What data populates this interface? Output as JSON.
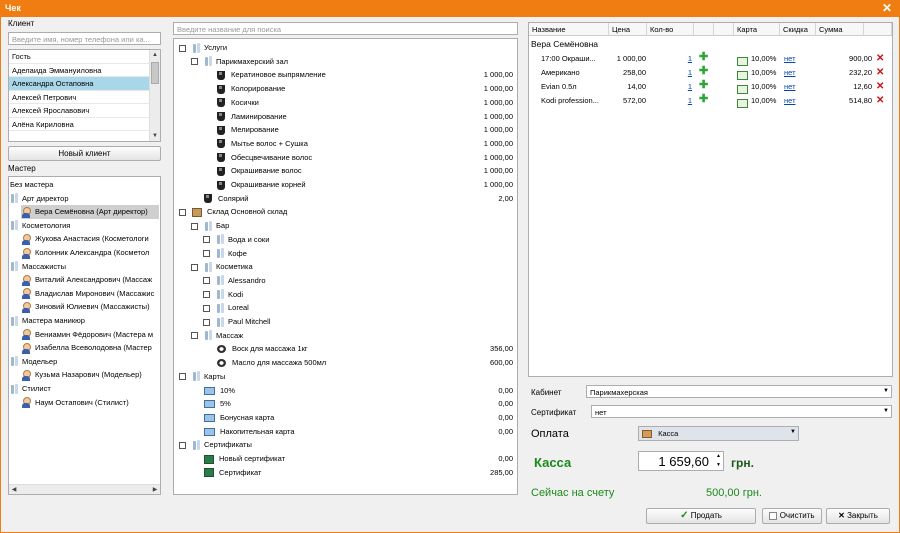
{
  "window": {
    "title": "Чек"
  },
  "client": {
    "label": "Клиент",
    "search_placeholder": "Введите имя, номер телефона или ка...",
    "list": [
      "Гость",
      "Аделаида Эммануиловна",
      "Александра Остаповна",
      "Алексей Петрович",
      "Алексей Ярославович",
      "Алёна Кириловна"
    ],
    "selected_index": 2,
    "new_client_button": "Новый клиент"
  },
  "master": {
    "label": "Мастер",
    "rows": [
      {
        "type": "plain",
        "text": "Без мастера"
      },
      {
        "type": "group",
        "text": "Арт директор"
      },
      {
        "type": "person",
        "text": "Вера Семёновна (Арт директор)",
        "selected": true
      },
      {
        "type": "group",
        "text": "Косметология"
      },
      {
        "type": "person",
        "text": "Жукова Анастасия (Косметологи"
      },
      {
        "type": "person",
        "text": "Колонник Александра (Косметол"
      },
      {
        "type": "group",
        "text": "Массажисты"
      },
      {
        "type": "person",
        "text": "Виталий Александрович (Массаж"
      },
      {
        "type": "person",
        "text": "Владислав Миронович (Массажис"
      },
      {
        "type": "person",
        "text": "Зиновий Юлиевич (Массажисты)"
      },
      {
        "type": "group",
        "text": "Мастера маникюр"
      },
      {
        "type": "person",
        "text": "Вениамин Фёдорович (Мастера м"
      },
      {
        "type": "person",
        "text": "Изабелла Всеволодовна (Мастер"
      },
      {
        "type": "group",
        "text": "Модельер"
      },
      {
        "type": "person",
        "text": "Кузьма Назарович (Модельер)"
      },
      {
        "type": "group",
        "text": "Стилист"
      },
      {
        "type": "person",
        "text": "Наум Остапович (Стилист)"
      }
    ]
  },
  "services": {
    "search_placeholder": "Введите название для поиска",
    "rows": [
      {
        "level": 0,
        "check": true,
        "icon": "group",
        "text": "Услуги",
        "price": ""
      },
      {
        "level": 1,
        "check": true,
        "icon": "group",
        "text": "Парикмахерский зал",
        "price": ""
      },
      {
        "level": 2,
        "check": false,
        "icon": "drop",
        "text": "Кератиновое выпрямление",
        "price": "1 000,00"
      },
      {
        "level": 2,
        "check": false,
        "icon": "drop",
        "text": "Колорирование",
        "price": "1 000,00"
      },
      {
        "level": 2,
        "check": false,
        "icon": "drop",
        "text": "Косички",
        "price": "1 000,00"
      },
      {
        "level": 2,
        "check": false,
        "icon": "drop",
        "text": "Ламинирование",
        "price": "1 000,00"
      },
      {
        "level": 2,
        "check": false,
        "icon": "drop",
        "text": "Мелирование",
        "price": "1 000,00"
      },
      {
        "level": 2,
        "check": false,
        "icon": "drop",
        "text": "Мытье волос + Сушка",
        "price": "1 000,00"
      },
      {
        "level": 2,
        "check": false,
        "icon": "drop",
        "text": "Обесцвечивание волос",
        "price": "1 000,00"
      },
      {
        "level": 2,
        "check": false,
        "icon": "drop",
        "text": "Окрашивание волос",
        "price": "1 000,00"
      },
      {
        "level": 2,
        "check": false,
        "icon": "drop",
        "text": "Окрашивание корней",
        "price": "1 000,00"
      },
      {
        "level": 1,
        "check": false,
        "icon": "drop",
        "text": "Солярий",
        "price": "2,00"
      },
      {
        "level": 0,
        "check": true,
        "icon": "box",
        "text": "Склад Основной склад",
        "price": ""
      },
      {
        "level": 1,
        "check": true,
        "icon": "group",
        "text": "Бар",
        "price": ""
      },
      {
        "level": 2,
        "check": true,
        "icon": "group",
        "text": "Вода и соки",
        "price": ""
      },
      {
        "level": 2,
        "check": true,
        "icon": "group",
        "text": "Кофе",
        "price": ""
      },
      {
        "level": 1,
        "check": true,
        "icon": "group",
        "text": "Косметика",
        "price": ""
      },
      {
        "level": 2,
        "check": true,
        "icon": "group",
        "text": "Alessandro",
        "price": ""
      },
      {
        "level": 2,
        "check": true,
        "icon": "group",
        "text": "Kodi",
        "price": ""
      },
      {
        "level": 2,
        "check": true,
        "icon": "group",
        "text": "Loreal",
        "price": ""
      },
      {
        "level": 2,
        "check": true,
        "icon": "group",
        "text": "Paul Mitchell",
        "price": ""
      },
      {
        "level": 1,
        "check": true,
        "icon": "group",
        "text": "Массаж",
        "price": ""
      },
      {
        "level": 2,
        "check": false,
        "icon": "jar",
        "text": "Воск для массажа 1кг",
        "price": "356,00"
      },
      {
        "level": 2,
        "check": false,
        "icon": "jar",
        "text": "Масло для массажа 500мл",
        "price": "600,00"
      },
      {
        "level": 0,
        "check": true,
        "icon": "group",
        "text": "Карты",
        "price": ""
      },
      {
        "level": 1,
        "check": false,
        "icon": "card",
        "text": "10%",
        "price": "0,00"
      },
      {
        "level": 1,
        "check": false,
        "icon": "card",
        "text": "5%",
        "price": "0,00"
      },
      {
        "level": 1,
        "check": false,
        "icon": "card",
        "text": "Бонусная карта",
        "price": "0,00"
      },
      {
        "level": 1,
        "check": false,
        "icon": "card",
        "text": "Накопительная карта",
        "price": "0,00"
      },
      {
        "level": 0,
        "check": true,
        "icon": "group",
        "text": "Сертификаты",
        "price": ""
      },
      {
        "level": 1,
        "check": false,
        "icon": "cert",
        "text": "Новый сертификат",
        "price": "0,00"
      },
      {
        "level": 1,
        "check": false,
        "icon": "cert",
        "text": "Сертификат",
        "price": "285,00"
      }
    ]
  },
  "receipt": {
    "columns": [
      "Название",
      "Цена",
      "Кол-во",
      "",
      "",
      "Карта",
      "Скидка",
      "Сумма"
    ],
    "group_name": "Вера Семёновна",
    "items": [
      {
        "name": "17:00 Окраши...",
        "price": "1 000,00",
        "qty": "1",
        "card": "10,00%",
        "discount": "нет",
        "sum": "900,00"
      },
      {
        "name": "Американо",
        "price": "258,00",
        "qty": "1",
        "card": "10,00%",
        "discount": "нет",
        "sum": "232,20"
      },
      {
        "name": "Evian 0.5л",
        "price": "14,00",
        "qty": "1",
        "card": "10,00%",
        "discount": "нет",
        "sum": "12,60"
      },
      {
        "name": "Kodi profession...",
        "price": "572,00",
        "qty": "1",
        "card": "10,00%",
        "discount": "нет",
        "sum": "514,80"
      }
    ]
  },
  "bottom": {
    "cabinet_label": "Кабинет",
    "cabinet_value": "Парикмахерская",
    "certificate_label": "Сертификат",
    "certificate_value": "нет",
    "payment_label": "Оплата",
    "payment_value": "Касса",
    "kassa_label": "Касса",
    "kassa_amount": "1 659,60",
    "kassa_currency": "грн.",
    "account_label": "Сейчас на счету",
    "account_value": "500,00 грн."
  },
  "actions": {
    "sell": "Продать",
    "clear": "Очистить",
    "close": "Закрыть"
  },
  "colors": {
    "title_bar": "#ef7d12",
    "selection": "#a9d7ea",
    "green_text": "#1a8a1a",
    "link": "#0645ad"
  }
}
